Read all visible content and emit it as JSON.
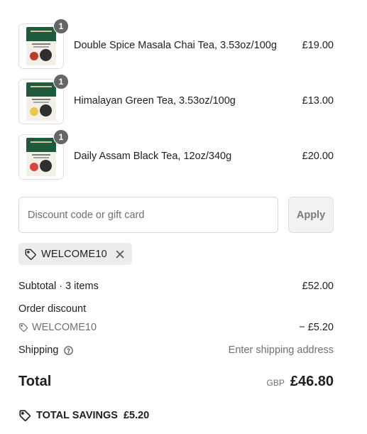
{
  "items": [
    {
      "name": "Double Spice Masala Chai Tea, 3.53oz/100g",
      "price": "£19.00",
      "quantity": "1",
      "colors": {
        "band": "#1f5a3c",
        "accent": "#c0392b"
      }
    },
    {
      "name": "Himalayan Green Tea, 3.53oz/100g",
      "price": "£13.00",
      "quantity": "1",
      "colors": {
        "band": "#1f5a3c",
        "accent": "#e9c84a"
      }
    },
    {
      "name": "Daily Assam Black Tea, 12oz/340g",
      "price": "£20.00",
      "quantity": "1",
      "colors": {
        "band": "#1f5a3c",
        "accent": "#d9453f"
      }
    }
  ],
  "discount": {
    "placeholder": "Discount code or gift card",
    "value": "",
    "apply_label": "Apply",
    "applied_code": "WELCOME10"
  },
  "summary": {
    "subtotal_label": "Subtotal · 3 items",
    "subtotal_value": "£52.00",
    "order_discount_label": "Order discount",
    "discount_code": "WELCOME10",
    "discount_value": "− £5.20",
    "shipping_label": "Shipping",
    "shipping_value": "Enter shipping address",
    "total_label": "Total",
    "currency": "GBP",
    "total_value": "£46.80",
    "savings_label": "TOTAL SAVINGS",
    "savings_value": "£5.20"
  },
  "icons": {
    "tag": "tag-icon",
    "close": "close-icon",
    "help": "help-circle-icon"
  },
  "theme": {
    "badge": "#666666",
    "muted_text": "#707070",
    "chip_bg": "#ededed",
    "apply_bg": "#f2f2f2"
  }
}
